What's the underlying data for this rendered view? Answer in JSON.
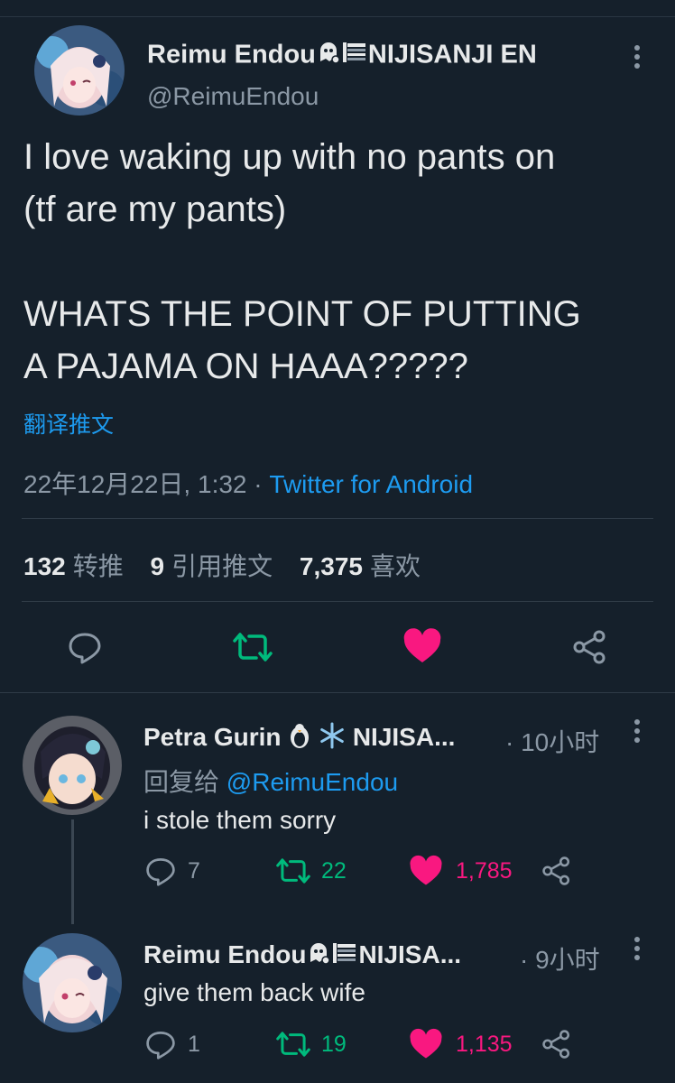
{
  "main": {
    "name": "Reimu Endou",
    "name_suffix": "NIJISANJI EN",
    "handle": "@ReimuEndou",
    "text_line1": "I love waking up with no pants on",
    "text_line2": "(tf are my pants)",
    "text_line3": "WHATS THE POINT OF PUTTING",
    "text_line4": "A PAJAMA ON HAAA?????",
    "translate": "翻译推文",
    "timestamp": "22年12月22日, 1:32",
    "separator": "·",
    "source": "Twitter for Android",
    "retweets_count": "132",
    "retweets_label": "转推",
    "quotes_count": "9",
    "quotes_label": "引用推文",
    "likes_count": "7,375",
    "likes_label": "喜欢"
  },
  "replies": [
    {
      "name": "Petra Gurin",
      "name_suffix": "NIJISA...",
      "time": "· 10小时",
      "reply_to_prefix": "回复给",
      "reply_to_handle": "@ReimuEndou",
      "text": "i stole them sorry",
      "replies": "7",
      "retweets": "22",
      "likes": "1,785"
    },
    {
      "name": "Reimu Endou",
      "name_suffix": "NIJISA...",
      "time": "· 9小时",
      "text": "give them back wife",
      "replies": "1",
      "retweets": "19",
      "likes": "1,135"
    }
  ],
  "colors": {
    "background": "#15202b",
    "accent": "#1d9bf0",
    "retweet": "#00ba7c",
    "like": "#f91880",
    "muted": "#8b98a5"
  },
  "icons": [
    "more-icon",
    "reply-icon",
    "retweet-icon",
    "like-icon",
    "share-icon",
    "ghost-icon",
    "flag-icon",
    "penguin-icon",
    "snowflake-icon"
  ]
}
